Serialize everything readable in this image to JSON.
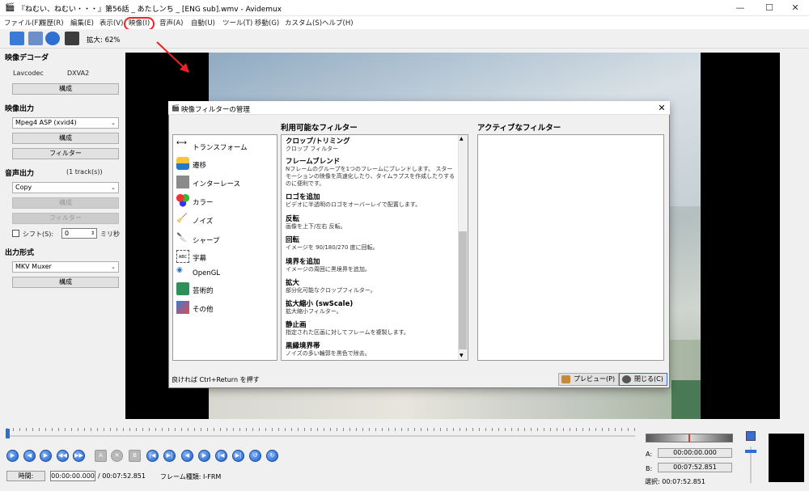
{
  "window": {
    "title": "『ねむい、ねむい・・・』第56話 _ あたしンち _ [ENG sub].wmv - Avidemux",
    "min_label": "—",
    "max_label": "☐",
    "close_label": "✕"
  },
  "menu": [
    "ファイル(F)",
    "履歴(R)",
    "編集(E)",
    "表示(V)",
    "映像(I)",
    "音声(A)",
    "自動(U)",
    "ツール(T)",
    "移動(G)",
    "カスタム(S)",
    "ヘルプ(H)"
  ],
  "toolbar": {
    "zoom_label": "拡大: 62%"
  },
  "left": {
    "video_decoder": {
      "title": "映像デコーダ",
      "codec_label": "Lavcodec",
      "codec_value": "DXVA2",
      "config_button": "構成"
    },
    "video_output": {
      "title": "映像出力",
      "codec": "Mpeg4 ASP (xvid4)",
      "config_button": "構成",
      "filter_button": "フィルター"
    },
    "audio_output": {
      "title": "音声出力",
      "tracks": "(1 track(s))",
      "codec": "Copy",
      "config_button": "構成",
      "filter_button": "フィルター",
      "shift_label": "シフト(S):",
      "shift_value": "0",
      "shift_unit": "ミリ秒"
    },
    "output_format": {
      "title": "出力形式",
      "muxer": "MKV Muxer",
      "config_button": "構成"
    }
  },
  "dialog": {
    "title": "映像フィルターの管理",
    "close_label": "✕",
    "available_header": "利用可能なフィルター",
    "active_header": "アクティブなフィルター",
    "categories": [
      "トランスフォーム",
      "遷移",
      "インターレース",
      "カラー",
      "ノイズ",
      "シャープ",
      "字幕",
      "OpenGL",
      "芸術的",
      "その他"
    ],
    "filters": [
      {
        "name": "クロップ/トリミング",
        "desc": "クロップ フィルター"
      },
      {
        "name": "フレームブレンド",
        "desc": "Nフレームのグループを1つのフレームにブレンドします。 スターモーションの映像を高速化したり、タイムラプスを作成したりするのに便利です。"
      },
      {
        "name": "ロゴを追加",
        "desc": "ビデオに半透明のロゴをオーバーレイで配置します。"
      },
      {
        "name": "反転",
        "desc": "画像を上下/左右 反転。"
      },
      {
        "name": "回転",
        "desc": "イメージを 90/180/270 度に回転。"
      },
      {
        "name": "境界を追加",
        "desc": "イメージの周囲に黒境界を追加。"
      },
      {
        "name": "拡大",
        "desc": "部分化可能なクロップフィルター。"
      },
      {
        "name": "拡大縮小 (swScale)",
        "desc": "拡大縮小フィルター。"
      },
      {
        "name": "静止画",
        "desc": "指定された区画に対してフレームを複製します。"
      },
      {
        "name": "黒縁境界帯",
        "desc": "ノイズの多い輪郭を黒色で除去。"
      }
    ],
    "hint": "良ければ Ctrl+Return を押す",
    "preview_button": "プレビュー(P)",
    "close_button": "閉じる(C)"
  },
  "playback": {
    "time_label": "時間:",
    "current_time": "00:00:00.000",
    "total_time": "/ 00:07:52.851",
    "frame_type": "フレーム種類: I-FRM",
    "marker_a_label": "A:",
    "marker_a": "00:00:00.000",
    "marker_b_label": "B:",
    "marker_b": "00:07:52.851",
    "selection_label": "選択: 00:07:52.851"
  },
  "colors": {
    "accent": "#2b6ed6",
    "highlight": "#e22222"
  }
}
